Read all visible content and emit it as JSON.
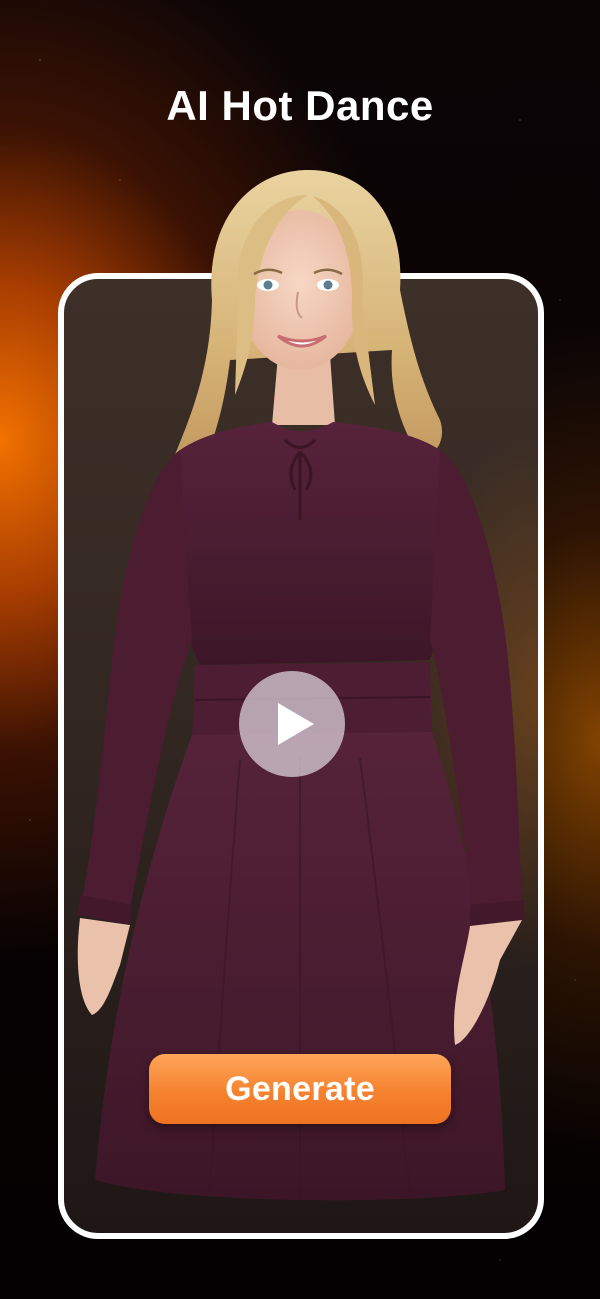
{
  "header": {
    "title": "AI Hot Dance"
  },
  "preview": {
    "media": "dancer-preview-image",
    "play_icon": "play-icon"
  },
  "actions": {
    "generate_label": "Generate"
  },
  "colors": {
    "accent": "#F5822F",
    "background": "#050203",
    "frame_border": "#FFFFFF",
    "dress": "#4A1D2E"
  }
}
